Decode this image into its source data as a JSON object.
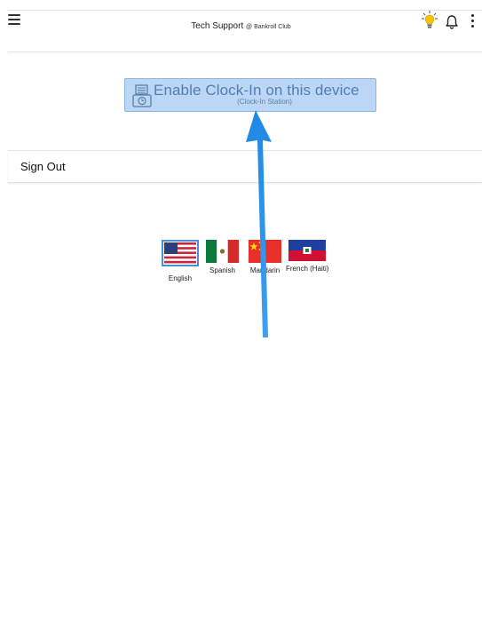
{
  "header": {
    "title": "Tech Support",
    "subtitle": "@ Bankroll Club"
  },
  "clock_in": {
    "label": "Enable Clock-In on this device",
    "sublabel": "(Clock-In Station)"
  },
  "menu": {
    "sign_out_label": "Sign Out"
  },
  "languages": [
    {
      "label": "English",
      "selected": true
    },
    {
      "label": "Spanish",
      "selected": false
    },
    {
      "label": "Mandarin",
      "selected": false
    },
    {
      "label": "French (Haiti)",
      "selected": false
    }
  ],
  "colors": {
    "accent_blue": "#1e88e5",
    "button_bg": "#bcd7f5",
    "bulb": "#f5c400"
  },
  "icons": {
    "menu": "hamburger-icon",
    "bulb": "lightbulb-icon",
    "bell": "bell-icon",
    "more": "kebab-icon",
    "clock_in": "clock-station-icon"
  }
}
